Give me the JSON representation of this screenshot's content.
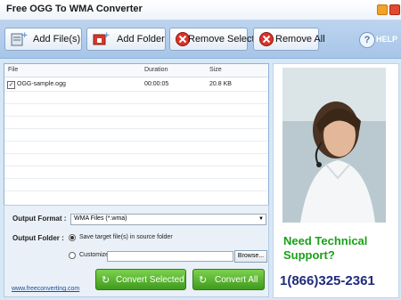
{
  "window": {
    "title": "Free OGG To WMA Converter"
  },
  "toolbar": {
    "add_files": "Add File(s)",
    "add_folder": "Add Folder",
    "remove_selected": "Remove Selected",
    "remove_all": "Remove All",
    "help": "HELP"
  },
  "file_list": {
    "columns": [
      "File",
      "Duration",
      "Size"
    ],
    "rows": [
      {
        "checked": true,
        "file": "OGG-sample.ogg",
        "duration": "00:00:05",
        "size": "20.8 KB"
      }
    ]
  },
  "output": {
    "format_label": "Output Format :",
    "format_value": "WMA Files (*.wma)",
    "folder_label": "Output Folder :",
    "radio_source": "Save target file(s) in source folder",
    "radio_custom": "Customize :",
    "custom_value": "",
    "browse": "Browse...",
    "source_selected": true
  },
  "actions": {
    "convert_selected": "Convert Selected",
    "convert_all": "Convert All"
  },
  "footer": {
    "link": "www.freeconverting.com"
  },
  "ad": {
    "line1": "Need Technical",
    "line2": "Support?",
    "phone": "1(866)325-2361"
  },
  "colors": {
    "accent_green": "#3f9a1d",
    "ad_green": "#1aa01a",
    "phone_blue": "#1f2a7a"
  }
}
